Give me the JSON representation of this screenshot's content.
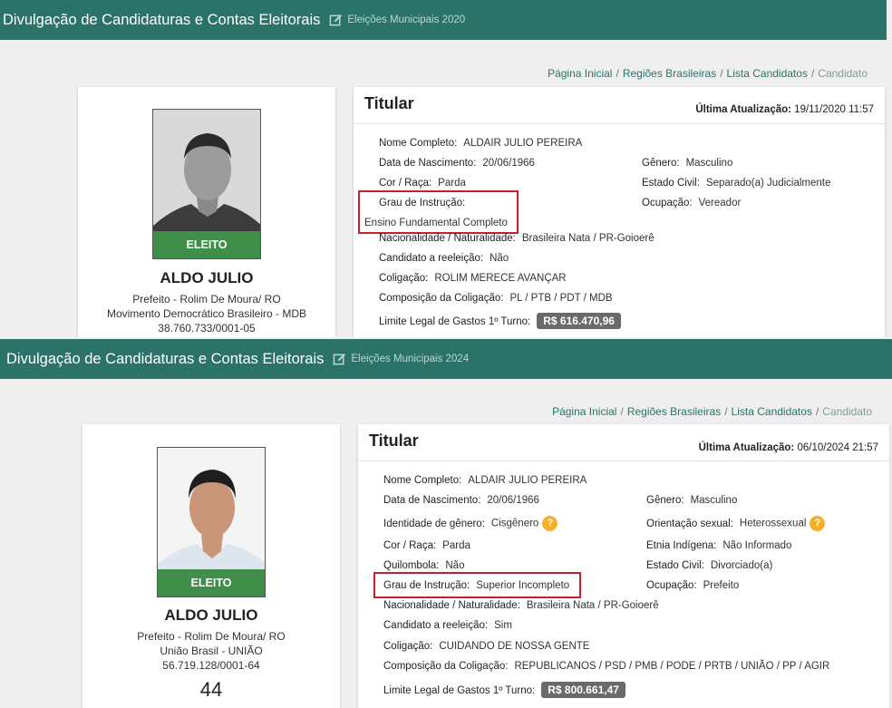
{
  "panels": [
    {
      "header": {
        "title": "Divulgação de Candidaturas e Contas Eleitorais",
        "election": "Eleições Municipais 2020"
      },
      "breadcrumb": {
        "home": "Página Inicial",
        "regions": "Regiões Brasileiras",
        "list": "Lista Candidatos",
        "current": "Candidato"
      },
      "candidate": {
        "status_badge": "ELEITO",
        "name": "ALDO JULIO",
        "office": "Prefeito - Rolim De Moura/ RO",
        "party": "Movimento Democrático Brasileiro - MDB",
        "cnpj": "38.760.733/0001-05"
      },
      "details": {
        "section_title": "Titular",
        "updated_label": "Última Atualização:",
        "updated_value": "19/11/2020 11:57",
        "full_name": {
          "label": "Nome Completo:",
          "value": "ALDAIR JULIO PEREIRA"
        },
        "birth_date": {
          "label": "Data de Nascimento:",
          "value": "20/06/1966"
        },
        "gender": {
          "label": "Gênero:",
          "value": "Masculino"
        },
        "race": {
          "label": "Cor / Raça:",
          "value": "Parda"
        },
        "civil_status": {
          "label": "Estado Civil:",
          "value": "Separado(a) Judicialmente"
        },
        "education": {
          "label": "Grau de Instrução:",
          "value": "Ensino Fundamental Completo"
        },
        "occupation": {
          "label": "Ocupação:",
          "value": "Vereador"
        },
        "nationality": {
          "label": "Nacionalidade / Naturalidade:",
          "value": "Brasileira Nata / PR-Goioerê"
        },
        "reelection": {
          "label": "Candidato a reeleição:",
          "value": "Não"
        },
        "coalition": {
          "label": "Coligação:",
          "value": "ROLIM MERECE AVANÇAR"
        },
        "coalition_parties": {
          "label": "Composição da Coligação:",
          "value": "PL / PTB / PDT / MDB"
        },
        "spending_limit": {
          "label": "Limite Legal de Gastos 1º Turno:",
          "value": "R$ 616.470,96"
        }
      }
    },
    {
      "header": {
        "title": "Divulgação de Candidaturas e Contas Eleitorais",
        "election": "Eleições Municipais 2024"
      },
      "breadcrumb": {
        "home": "Página Inicial",
        "regions": "Regiões Brasileiras",
        "list": "Lista Candidatos",
        "current": "Candidato"
      },
      "candidate": {
        "status_badge": "ELEITO",
        "name": "ALDO JULIO",
        "office": "Prefeito - Rolim De Moura/ RO",
        "party": "União Brasil - UNIÃO",
        "cnpj": "56.719.128/0001-64",
        "number": "44"
      },
      "details": {
        "section_title": "Titular",
        "updated_label": "Última Atualização:",
        "updated_value": "06/10/2024 21:57",
        "full_name": {
          "label": "Nome Completo:",
          "value": "ALDAIR JULIO PEREIRA"
        },
        "birth_date": {
          "label": "Data de Nascimento:",
          "value": "20/06/1966"
        },
        "gender": {
          "label": "Gênero:",
          "value": "Masculino"
        },
        "gender_identity": {
          "label": "Identidade de gênero:",
          "value": "Cisgênero"
        },
        "sexual_orientation": {
          "label": "Orientação sexual:",
          "value": "Heterossexual"
        },
        "race": {
          "label": "Cor / Raça:",
          "value": "Parda"
        },
        "indigenous": {
          "label": "Etnia Indígena:",
          "value": "Não Informado"
        },
        "quilombola": {
          "label": "Quilombola:",
          "value": "Não"
        },
        "civil_status": {
          "label": "Estado Civil:",
          "value": "Divorciado(a)"
        },
        "education": {
          "label": "Grau de Instrução:",
          "value": "Superior Incompleto"
        },
        "occupation": {
          "label": "Ocupação:",
          "value": "Prefeito"
        },
        "nationality": {
          "label": "Nacionalidade / Naturalidade:",
          "value": "Brasileira Nata / PR-Goioerê"
        },
        "reelection": {
          "label": "Candidato a reeleição:",
          "value": "Sim"
        },
        "coalition": {
          "label": "Coligação:",
          "value": "CUIDANDO DE NOSSA GENTE"
        },
        "coalition_parties": {
          "label": "Composição da Coligação:",
          "value": "REPUBLICANOS / PSD / PMB / PODE / PRTB / UNIÃO / PP / AGIR"
        },
        "spending_limit": {
          "label": "Limite Legal de Gastos 1º Turno:",
          "value": "R$ 800.661,47"
        }
      }
    }
  ],
  "icons": {
    "edit": "edit-icon",
    "help": "help-icon",
    "help_glyph": "?"
  },
  "colors": {
    "header": "#2b7269",
    "badge": "#3f8f4a",
    "highlight": "#c7202d",
    "help": "#f3b02b"
  }
}
